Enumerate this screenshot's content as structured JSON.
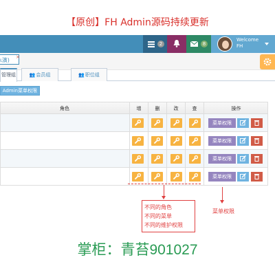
{
  "promo": {
    "title": "【原创】FH Admin源码持续更新"
  },
  "navbar": {
    "tasks_count": "2",
    "messages_count": "8",
    "user_welcome": "Welcome",
    "user_name": "FH"
  },
  "breadcrumbs": {
    "current_tab": "ι演)",
    "close": "×"
  },
  "subtabs": [
    {
      "label": "管理组"
    },
    {
      "label": "会员组"
    },
    {
      "label": "职位组"
    }
  ],
  "toolbar": {
    "menu_permission_button": "Admin菜单权限"
  },
  "table": {
    "headers": {
      "role": "角色",
      "add": "增",
      "delete": "删",
      "edit": "改",
      "query": "查",
      "operation": "操作"
    },
    "rows": [
      {
        "menu_label": "菜单权限"
      },
      {
        "menu_label": "菜单权限"
      },
      {
        "menu_label": "菜单权限"
      },
      {
        "menu_label": "菜单权限"
      }
    ]
  },
  "annotations": {
    "crud_lines": [
      "不同的角色",
      "不同的菜单",
      "不同的维护权限"
    ],
    "menu_note": "菜单权限"
  },
  "contact": {
    "text": "掌柜：青苔901027"
  },
  "colors": {
    "navbar": "#438eb9",
    "tasks": "#2e6589",
    "alerts": "#892e65",
    "messages": "#2e8965",
    "user": "#62a8d1",
    "perm_square": "#f7b341",
    "menu_perm": "#9585bf",
    "edit": "#6fb3e0",
    "delete": "#d15b47",
    "annotation": "#e04040",
    "contact": "#2a9b54",
    "promo": "#d9302b"
  },
  "icons": {
    "tasks": "tasks-icon",
    "alerts": "bell-icon",
    "messages": "envelope-icon",
    "settings": "gear-icon",
    "crud": "wrench-icon",
    "edit": "pencil-square-icon",
    "delete": "trash-icon",
    "subtab": "users-icon"
  }
}
